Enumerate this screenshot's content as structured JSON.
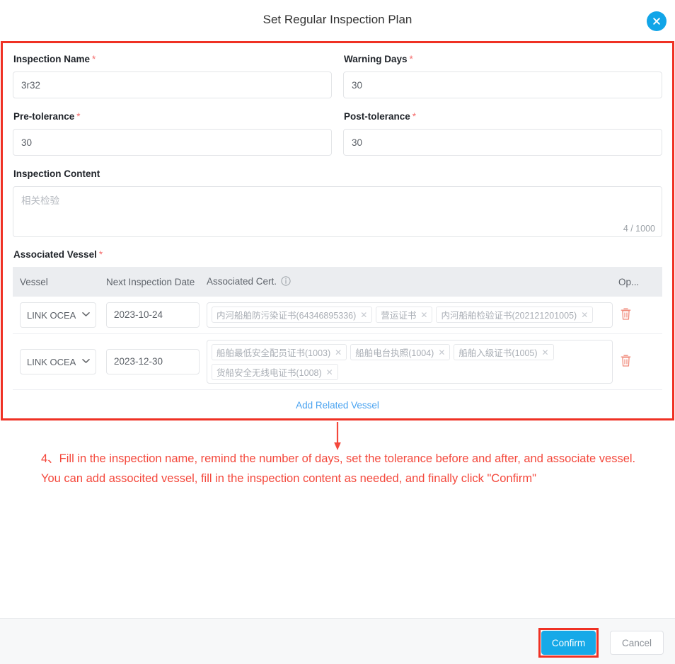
{
  "dialog": {
    "title": "Set Regular Inspection Plan",
    "close_icon": "close-icon"
  },
  "form": {
    "inspection_name": {
      "label": "Inspection Name",
      "required": "*",
      "value": "3r32"
    },
    "warning_days": {
      "label": "Warning Days",
      "required": "*",
      "value": "30"
    },
    "pre_tolerance": {
      "label": "Pre-tolerance",
      "required": "*",
      "value": "30"
    },
    "post_tolerance": {
      "label": "Post-tolerance",
      "required": "*",
      "value": "30"
    },
    "inspection_content": {
      "label": "Inspection Content",
      "placeholder": "相关检验",
      "value": "",
      "counter": "4 / 1000"
    },
    "associated_vessel": {
      "label": "Associated Vessel",
      "required": "*"
    }
  },
  "table": {
    "headers": {
      "vessel": "Vessel",
      "next_inspection_date": "Next Inspection Date",
      "associated_cert": "Associated Cert.",
      "cert_info_icon": "info-circle-icon",
      "operation": "Op..."
    },
    "rows": [
      {
        "vessel": "LINK OCEA",
        "date": "2023-10-24",
        "certs": [
          "内河船舶防污染证书(64346895336)",
          "营运证书",
          "内河船舶检验证书(202121201005)"
        ],
        "delete_icon": "trash-icon"
      },
      {
        "vessel": "LINK OCEA",
        "date": "2023-12-30",
        "certs": [
          "船舶最低安全配员证书(1003)",
          "船舶电台执照(1004)",
          "船舶入级证书(1005)",
          "货船安全无线电证书(1008)"
        ],
        "delete_icon": "trash-icon"
      }
    ],
    "add_link": "Add Related Vessel",
    "tag_remove_glyph": "✕"
  },
  "annotation": {
    "text": "4、Fill in the inspection name, remind the number of days, set  the tolerance before and after, and associate vessel. You can add associted vessel, fill in the inspection content as needed, and finally click \"Confirm\"",
    "color": "#f4483c"
  },
  "footer": {
    "confirm_label": "Confirm",
    "cancel_label": "Cancel"
  },
  "colors": {
    "accent": "#16a9e8",
    "highlight": "#ef3124",
    "required": "#f56c6c",
    "link": "#4aa3f0",
    "header_bg": "#ebedf0",
    "footer_bg": "#f7f8f9",
    "delete": "#f08a7a"
  }
}
